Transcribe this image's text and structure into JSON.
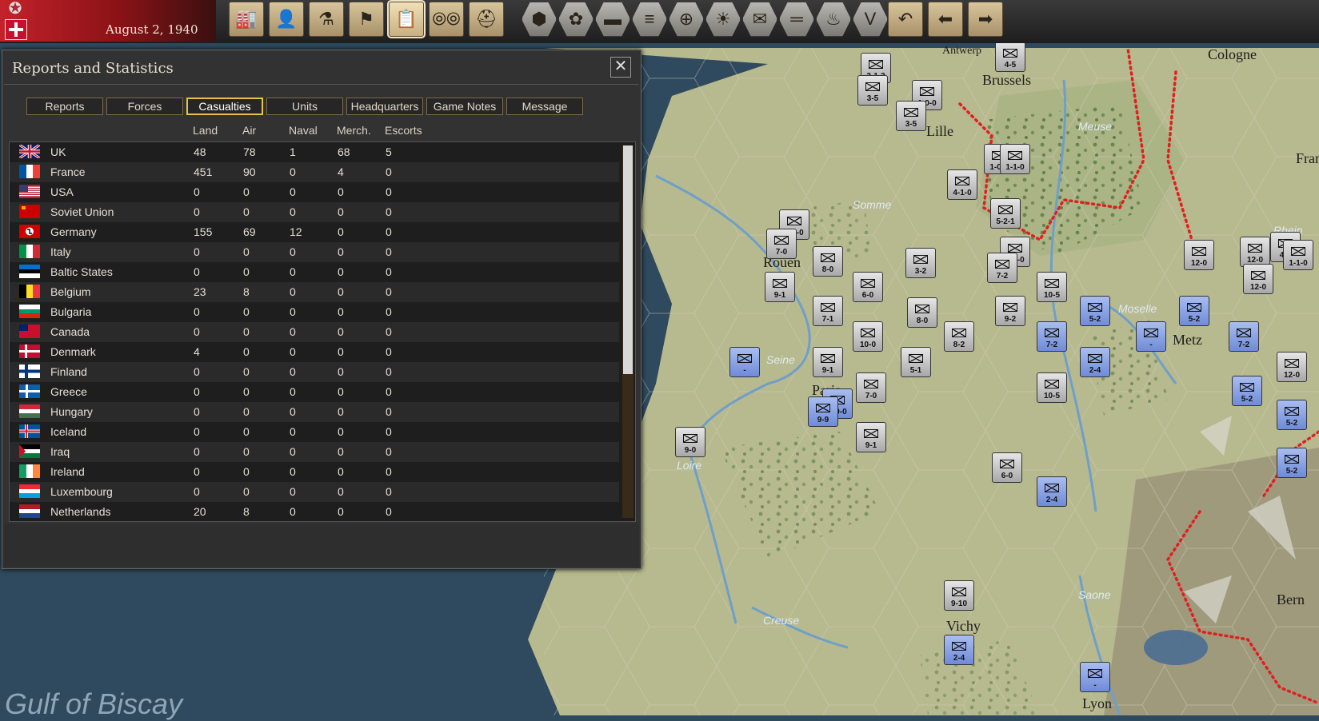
{
  "top_bar": {
    "date": "August 2, 1940",
    "buttons": [
      {
        "name": "production-icon",
        "glyph": "🏭"
      },
      {
        "name": "diplomacy-icon",
        "glyph": "👤"
      },
      {
        "name": "research-icon",
        "glyph": "⚗"
      },
      {
        "name": "objectives-flag-icon",
        "glyph": "⚑"
      },
      {
        "name": "reports-icon",
        "glyph": "📋"
      },
      {
        "name": "intelligence-binoculars-icon",
        "glyph": "⦾⦾"
      },
      {
        "name": "helmet-icon",
        "glyph": "⛑"
      },
      {
        "name": "hex-icon",
        "glyph": "⬢"
      },
      {
        "name": "hex-cluster-icon",
        "glyph": "✿"
      },
      {
        "name": "tank-icon",
        "glyph": "▬"
      },
      {
        "name": "supply-icon",
        "glyph": "≡"
      },
      {
        "name": "target-icon",
        "glyph": "⊕"
      },
      {
        "name": "weather-sun-icon",
        "glyph": "☀"
      },
      {
        "name": "envelope-icon",
        "glyph": "✉"
      },
      {
        "name": "lines-icon",
        "glyph": "═"
      },
      {
        "name": "flame-icon",
        "glyph": "♨"
      },
      {
        "name": "victory-icon",
        "glyph": "V"
      },
      {
        "name": "undo-icon",
        "glyph": "↶"
      },
      {
        "name": "prev-arrow-icon",
        "glyph": "⬅"
      },
      {
        "name": "next-arrow-icon",
        "glyph": "➡"
      }
    ]
  },
  "dialog": {
    "title": "Reports and Statistics",
    "tabs": [
      "Reports",
      "Forces",
      "Casualties",
      "Units",
      "Headquarters",
      "Game Notes",
      "Message"
    ],
    "active_tab": "Casualties",
    "columns": [
      "Land",
      "Air",
      "Naval",
      "Merch.",
      "Escorts"
    ],
    "rows": [
      {
        "country": "UK",
        "land": "48",
        "air": "78",
        "naval": "1",
        "merch": "68",
        "escorts": "5",
        "flag": "uk"
      },
      {
        "country": "France",
        "land": "451",
        "air": "90",
        "naval": "0",
        "merch": "4",
        "escorts": "0",
        "flag": "france"
      },
      {
        "country": "USA",
        "land": "0",
        "air": "0",
        "naval": "0",
        "merch": "0",
        "escorts": "0",
        "flag": "usa"
      },
      {
        "country": "Soviet Union",
        "land": "0",
        "air": "0",
        "naval": "0",
        "merch": "0",
        "escorts": "0",
        "flag": "soviet"
      },
      {
        "country": "Germany",
        "land": "155",
        "air": "69",
        "naval": "12",
        "merch": "0",
        "escorts": "0",
        "flag": "germany"
      },
      {
        "country": "Italy",
        "land": "0",
        "air": "0",
        "naval": "0",
        "merch": "0",
        "escorts": "0",
        "flag": "italy"
      },
      {
        "country": "Baltic States",
        "land": "0",
        "air": "0",
        "naval": "0",
        "merch": "0",
        "escorts": "0",
        "flag": "baltic"
      },
      {
        "country": "Belgium",
        "land": "23",
        "air": "8",
        "naval": "0",
        "merch": "0",
        "escorts": "0",
        "flag": "belgium"
      },
      {
        "country": "Bulgaria",
        "land": "0",
        "air": "0",
        "naval": "0",
        "merch": "0",
        "escorts": "0",
        "flag": "bulgaria"
      },
      {
        "country": "Canada",
        "land": "0",
        "air": "0",
        "naval": "0",
        "merch": "0",
        "escorts": "0",
        "flag": "canada"
      },
      {
        "country": "Denmark",
        "land": "4",
        "air": "0",
        "naval": "0",
        "merch": "0",
        "escorts": "0",
        "flag": "denmark"
      },
      {
        "country": "Finland",
        "land": "0",
        "air": "0",
        "naval": "0",
        "merch": "0",
        "escorts": "0",
        "flag": "finland"
      },
      {
        "country": "Greece",
        "land": "0",
        "air": "0",
        "naval": "0",
        "merch": "0",
        "escorts": "0",
        "flag": "greece"
      },
      {
        "country": "Hungary",
        "land": "0",
        "air": "0",
        "naval": "0",
        "merch": "0",
        "escorts": "0",
        "flag": "hungary"
      },
      {
        "country": "Iceland",
        "land": "0",
        "air": "0",
        "naval": "0",
        "merch": "0",
        "escorts": "0",
        "flag": "iceland"
      },
      {
        "country": "Iraq",
        "land": "0",
        "air": "0",
        "naval": "0",
        "merch": "0",
        "escorts": "0",
        "flag": "iraq"
      },
      {
        "country": "Ireland",
        "land": "0",
        "air": "0",
        "naval": "0",
        "merch": "0",
        "escorts": "0",
        "flag": "ireland"
      },
      {
        "country": "Luxembourg",
        "land": "0",
        "air": "0",
        "naval": "0",
        "merch": "0",
        "escorts": "0",
        "flag": "luxembourg"
      },
      {
        "country": "Netherlands",
        "land": "20",
        "air": "8",
        "naval": "0",
        "merch": "0",
        "escorts": "0",
        "flag": "netherlands"
      }
    ]
  },
  "map": {
    "cities": [
      "Antwerp",
      "Brussels",
      "Cologne",
      "Lille",
      "Rouen",
      "Paris",
      "Metz",
      "Vichy",
      "Bern",
      "Lyon",
      "Fran"
    ],
    "rivers": [
      "Meuse",
      "Somme",
      "Seine",
      "Moselle",
      "Loire",
      "Creuse",
      "Saone",
      "Rhein"
    ],
    "sea": "Gulf of Biscay",
    "units": [
      {
        "side": "g",
        "stat": "3-1-3"
      },
      {
        "side": "g",
        "stat": "3-5"
      },
      {
        "side": "g",
        "stat": "1-0-0"
      },
      {
        "side": "g",
        "stat": "3-5"
      },
      {
        "side": "g",
        "stat": "1-0-0"
      },
      {
        "side": "g",
        "stat": "1-1-0"
      },
      {
        "side": "g",
        "stat": "4-1-0"
      },
      {
        "side": "g",
        "stat": "5-2-1"
      },
      {
        "side": "g",
        "stat": "4-1-0"
      },
      {
        "side": "g",
        "stat": "7-0"
      },
      {
        "side": "g",
        "stat": "8-0"
      },
      {
        "side": "g",
        "stat": "3-2"
      },
      {
        "side": "g",
        "stat": "4-1-0"
      },
      {
        "side": "g",
        "stat": "7-2"
      },
      {
        "side": "g",
        "stat": "9-1"
      },
      {
        "side": "g",
        "stat": "6-0"
      },
      {
        "side": "g",
        "stat": "10-5"
      },
      {
        "side": "g",
        "stat": "7-1"
      },
      {
        "side": "g",
        "stat": "8-0"
      },
      {
        "side": "g",
        "stat": "9-2"
      },
      {
        "side": "b",
        "stat": "5-2"
      },
      {
        "side": "b",
        "stat": "5-2"
      },
      {
        "side": "g",
        "stat": "10-0"
      },
      {
        "side": "g",
        "stat": "8-2"
      },
      {
        "side": "b",
        "stat": "7-2"
      },
      {
        "side": "b",
        "stat": "-"
      },
      {
        "side": "b",
        "stat": "7-2"
      },
      {
        "side": "b",
        "stat": "-"
      },
      {
        "side": "g",
        "stat": "9-1"
      },
      {
        "side": "g",
        "stat": "5-1"
      },
      {
        "side": "b",
        "stat": "2-4"
      },
      {
        "side": "g",
        "stat": "7-0"
      },
      {
        "side": "b",
        "stat": "0-0-0"
      },
      {
        "side": "b",
        "stat": "9-9"
      },
      {
        "side": "g",
        "stat": "10-5"
      },
      {
        "side": "g",
        "stat": "9-0"
      },
      {
        "side": "g",
        "stat": "9-1"
      },
      {
        "side": "g",
        "stat": "6-0"
      },
      {
        "side": "b",
        "stat": "2-4"
      },
      {
        "side": "g",
        "stat": "9-10"
      },
      {
        "side": "b",
        "stat": "2-4"
      },
      {
        "side": "b",
        "stat": "-"
      },
      {
        "side": "g",
        "stat": "12-0"
      },
      {
        "side": "g",
        "stat": "12-0"
      },
      {
        "side": "g",
        "stat": "12-0"
      },
      {
        "side": "b",
        "stat": "5-2"
      },
      {
        "side": "b",
        "stat": "5-2"
      },
      {
        "side": "b",
        "stat": "5-2"
      },
      {
        "side": "g",
        "stat": "4-1"
      },
      {
        "side": "g",
        "stat": "1-1-0"
      },
      {
        "side": "g",
        "stat": "12-0"
      },
      {
        "side": "g",
        "stat": "4-5"
      }
    ]
  },
  "colors": {
    "dialog_bg": "#323232",
    "active_tab": "#e6c24a",
    "land": "#b7b98e",
    "sea": "#2f4a5e",
    "border_red": "#e02020"
  }
}
